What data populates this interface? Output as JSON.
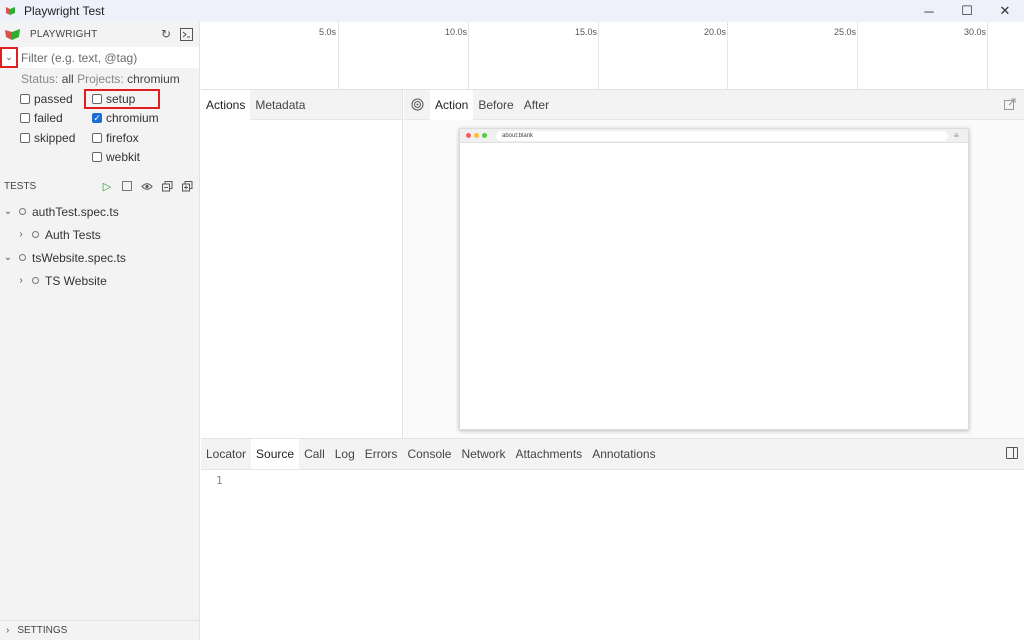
{
  "window": {
    "title": "Playwright Test",
    "controls": {
      "minimize": "─",
      "maximize": "☐",
      "close": "✕"
    }
  },
  "sidebar": {
    "header": {
      "title": "PLAYWRIGHT"
    },
    "filter": {
      "placeholder": "Filter (e.g. text, @tag)",
      "value": ""
    },
    "status": {
      "label": "Status:",
      "value": "all",
      "projects_label": "Projects:",
      "projects_value": "chromium"
    },
    "status_options": [
      {
        "label": "passed",
        "checked": false
      },
      {
        "label": "failed",
        "checked": false
      },
      {
        "label": "skipped",
        "checked": false
      }
    ],
    "project_options": [
      {
        "label": "setup",
        "checked": false
      },
      {
        "label": "chromium",
        "checked": true
      },
      {
        "label": "firefox",
        "checked": false
      },
      {
        "label": "webkit",
        "checked": false
      }
    ],
    "tests_header": "TESTS",
    "tree": [
      {
        "label": "authTest.spec.ts",
        "expanded": true,
        "level": 0
      },
      {
        "label": "Auth Tests",
        "expanded": false,
        "level": 1
      },
      {
        "label": "tsWebsite.spec.ts",
        "expanded": true,
        "level": 0
      },
      {
        "label": "TS Website",
        "expanded": false,
        "level": 1
      }
    ],
    "settings": "SETTINGS"
  },
  "timeline": {
    "ticks": [
      "5.0s",
      "10.0s",
      "15.0s",
      "20.0s",
      "25.0s",
      "30.0s"
    ]
  },
  "actions_pane": {
    "tabs": [
      "Actions",
      "Metadata"
    ]
  },
  "snapshot_pane": {
    "tabs": [
      "Action",
      "Before",
      "After"
    ],
    "browser_url": "about:blank"
  },
  "bottom_pane": {
    "tabs": [
      "Locator",
      "Source",
      "Call",
      "Log",
      "Errors",
      "Console",
      "Network",
      "Attachments",
      "Annotations"
    ],
    "active_tab": "Source",
    "line_number": "1"
  },
  "colors": {
    "accent": "#1a6fd6",
    "highlight": "#e02020",
    "play": "#2a9d3a"
  }
}
